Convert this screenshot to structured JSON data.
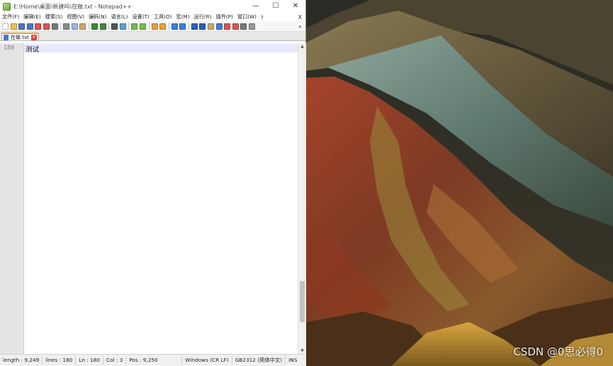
{
  "window": {
    "title": "E:\\Home\\桌面\\新建吗\\在做.txt - Notepad++",
    "minimize": "—",
    "maximize": "☐",
    "close": "✕"
  },
  "menu": {
    "items": [
      "文件(F)",
      "编辑(E)",
      "搜索(S)",
      "视图(V)",
      "编码(N)",
      "语言(L)",
      "设置(T)",
      "工具(O)",
      "宏(M)",
      "运行(R)",
      "插件(P)",
      "窗口(W)",
      "?"
    ],
    "close": "X"
  },
  "toolbar": {
    "more": "»",
    "buttons": [
      {
        "icon": "new-file-icon",
        "color": "#ffffff"
      },
      {
        "icon": "open-file-icon",
        "color": "#f2c14e"
      },
      {
        "icon": "save-icon",
        "color": "#4a78c2"
      },
      {
        "icon": "save-all-icon",
        "color": "#4a78c2"
      },
      {
        "icon": "close-file-icon",
        "color": "#d9534f"
      },
      {
        "icon": "close-all-icon",
        "color": "#d9534f"
      },
      {
        "icon": "print-icon",
        "color": "#7a7a7a"
      },
      {
        "sep": true
      },
      {
        "icon": "cut-icon",
        "color": "#8a8a8a"
      },
      {
        "icon": "copy-icon",
        "color": "#9bb7e0"
      },
      {
        "icon": "paste-icon",
        "color": "#c9a86a"
      },
      {
        "sep": true
      },
      {
        "icon": "undo-icon",
        "color": "#3c8a3c"
      },
      {
        "icon": "redo-icon",
        "color": "#3c8a3c"
      },
      {
        "sep": true
      },
      {
        "icon": "find-icon",
        "color": "#555555"
      },
      {
        "icon": "replace-icon",
        "color": "#5aa0d8"
      },
      {
        "sep": true
      },
      {
        "icon": "zoom-in-icon",
        "color": "#6fbf4f"
      },
      {
        "icon": "zoom-out-icon",
        "color": "#6fbf4f"
      },
      {
        "sep": true
      },
      {
        "icon": "sync-v-icon",
        "color": "#e6a23c"
      },
      {
        "icon": "sync-h-icon",
        "color": "#e6a23c"
      },
      {
        "sep": true
      },
      {
        "icon": "word-wrap-icon",
        "color": "#3d7fd6"
      },
      {
        "icon": "show-all-icon",
        "color": "#3d7fd6"
      },
      {
        "sep": true
      },
      {
        "icon": "indent-guide-icon",
        "color": "#2e5fb8"
      },
      {
        "icon": "lang-define-icon",
        "color": "#2e5fb8"
      },
      {
        "icon": "doc-map-icon",
        "color": "#c9a86a"
      },
      {
        "icon": "function-list-icon",
        "color": "#3d7fd6"
      },
      {
        "icon": "folder-workspace-icon",
        "color": "#d9534f"
      },
      {
        "icon": "monitor-icon",
        "color": "#d9534f"
      },
      {
        "icon": "record-macro-icon",
        "color": "#7a7a7a"
      },
      {
        "icon": "play-macro-icon",
        "color": "#999999"
      }
    ]
  },
  "tabs": [
    {
      "label": "在做.txt",
      "active": true
    }
  ],
  "editor": {
    "line_number": "180",
    "line_text": "测试"
  },
  "scroll_position": 0.9,
  "statusbar": {
    "length": "length : 9,249",
    "lines": "lines : 180",
    "ln": "Ln : 180",
    "col": "Col : 3",
    "pos": "Pos : 9,250",
    "eol": "Windows (CR LF)",
    "encoding": "GB2312 (简体中文)",
    "mode": "INS"
  },
  "desktop": {
    "watermark": "CSDN @0思必得0"
  }
}
